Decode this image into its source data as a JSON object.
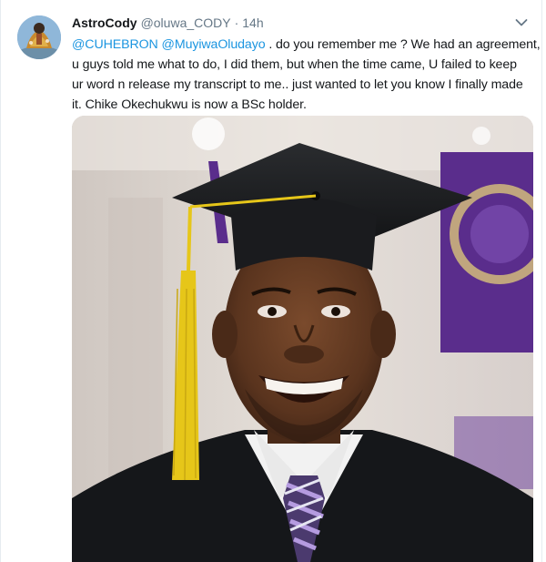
{
  "tweet": {
    "display_name": "AstroCody",
    "handle": "@oluwa_CODY",
    "separator": "·",
    "time": "14h",
    "mention_1": "@CUHEBRON",
    "mention_2": "@MuyiwaOludayo",
    "text_line_1_rest": ". do you remember me ? We had an agreement,",
    "text_line_2": "u guys told me what to do, I did them, but when the time came, U failed to keep",
    "text_line_3": "ur word n release my transcript to me.. just wanted to let you know I finally made",
    "text_line_4": "it. Chike Okechukwu is now a BSc holder."
  },
  "icons": {
    "caret": "chevron-down-icon"
  },
  "colors": {
    "link": "#1b95e0",
    "secondary_text": "#657786",
    "primary_text": "#14171a",
    "gown": "#15171a",
    "tassel": "#e6c619",
    "banner_purple": "#5a2d8c"
  }
}
